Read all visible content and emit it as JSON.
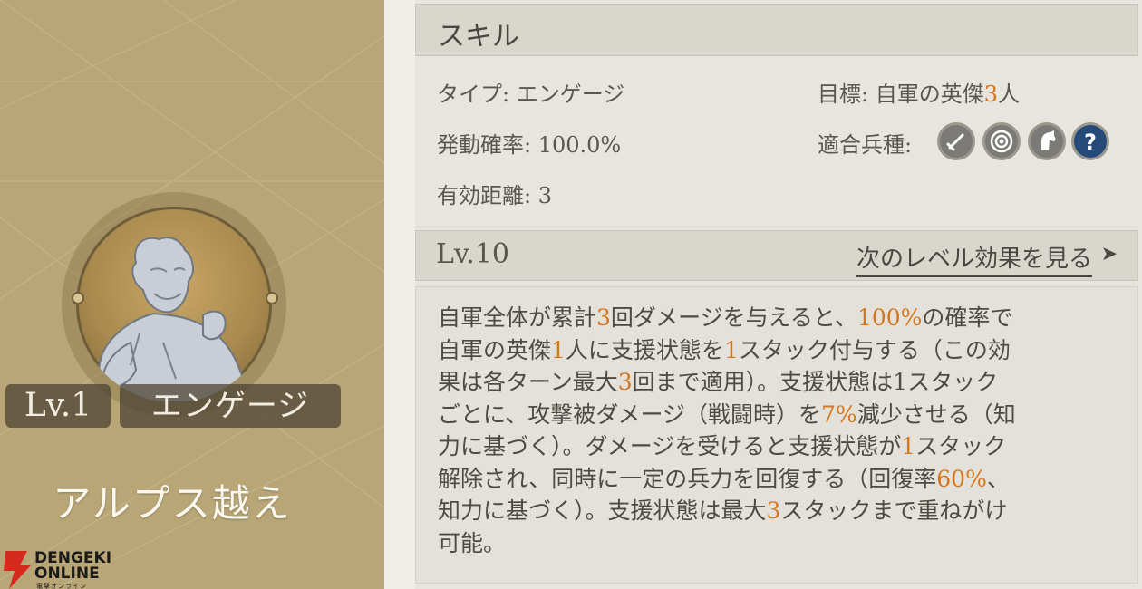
{
  "left": {
    "level_badge": "Lv.1",
    "skill_name": "エンゲージ",
    "title": "アルプス越え",
    "logo": {
      "line1": "DENGEKI",
      "line2": "ONLINE",
      "line3": "電撃オンライン"
    }
  },
  "skill": {
    "header": "スキル",
    "type_label": "タイプ: エンゲージ",
    "target_prefix": "目標: 自軍の英傑",
    "target_number": "3",
    "target_suffix": "人",
    "probability_label": "発動確率: 100.0%",
    "unit_types_label": "適合兵種:",
    "unit_icons": [
      "sword-icon",
      "target-icon",
      "horse-icon",
      "question-icon"
    ],
    "range_label": "有効距離: 3"
  },
  "level": {
    "label": "Lv.10",
    "next_level_link": "次のレベル効果を見る"
  },
  "description": {
    "lines": [
      [
        {
          "t": "自軍全体が累計"
        },
        {
          "t": "3",
          "h": true
        },
        {
          "t": "回ダメージを与えると、"
        },
        {
          "t": "100%",
          "h": true
        },
        {
          "t": "の確率で"
        }
      ],
      [
        {
          "t": "自軍の英傑"
        },
        {
          "t": "1",
          "h": true
        },
        {
          "t": "人に支援状態を"
        },
        {
          "t": "1",
          "h": true
        },
        {
          "t": "スタック付与する（この効"
        }
      ],
      [
        {
          "t": "果は各ターン最大"
        },
        {
          "t": "3",
          "h": true
        },
        {
          "t": "回まで適用）。支援状態は1スタック"
        }
      ],
      [
        {
          "t": "ごとに、攻撃被ダメージ（戦闘時）を"
        },
        {
          "t": "7%",
          "h": true
        },
        {
          "t": "減少させる（知"
        }
      ],
      [
        {
          "t": "力に基づく）。ダメージを受けると支援状態が"
        },
        {
          "t": "1",
          "h": true
        },
        {
          "t": "スタック"
        }
      ],
      [
        {
          "t": "解除され、同時に一定の兵力を回復する（回復率"
        },
        {
          "t": "60%",
          "h": true
        },
        {
          "t": "、"
        }
      ],
      [
        {
          "t": "知力に基づく）。支援状態は最大"
        },
        {
          "t": "3",
          "h": true
        },
        {
          "t": "スタックまで重ねがけ"
        }
      ],
      [
        {
          "t": "可能。"
        }
      ]
    ]
  },
  "colors": {
    "highlight": "#d4781f",
    "card": "#b9a676"
  }
}
